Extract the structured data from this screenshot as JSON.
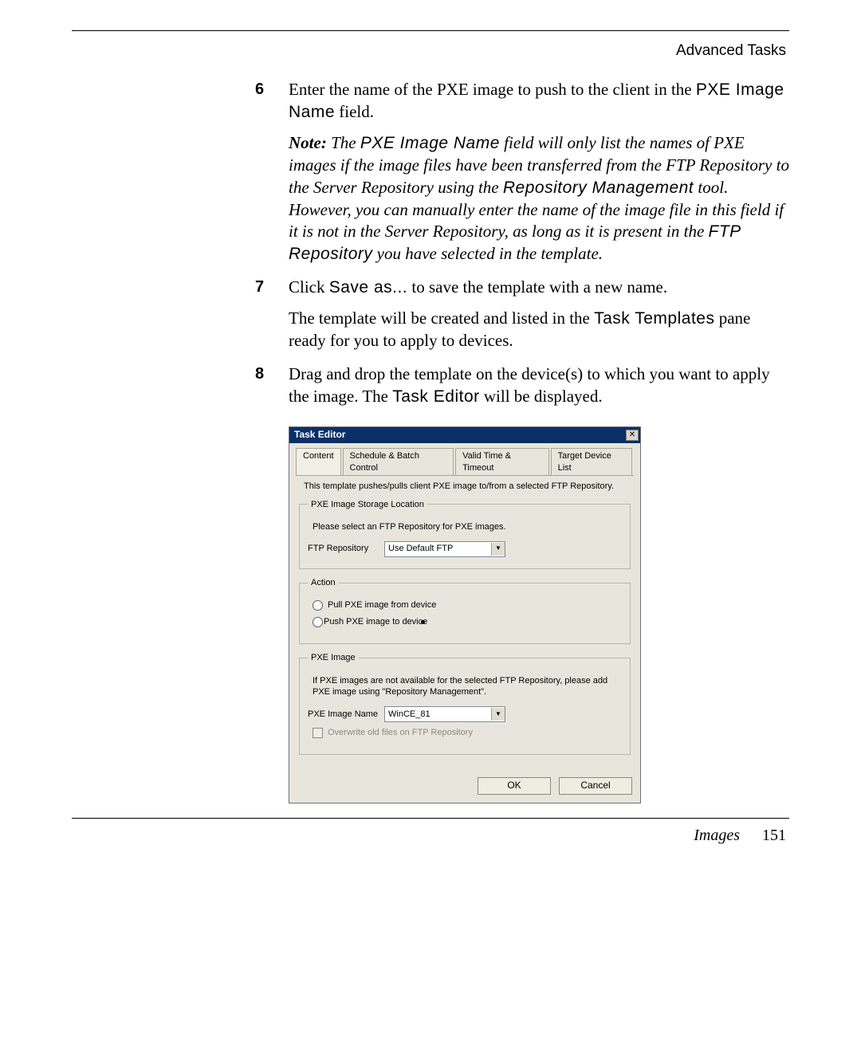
{
  "running_head": "Advanced Tasks",
  "steps": {
    "s6": {
      "num": "6",
      "pre": "Enter the name of the PXE image to push to the client in the ",
      "field1": "PXE Image Name",
      "post": " field."
    },
    "note": {
      "label": "Note:",
      "t1": " The ",
      "f1": "PXE Image Name",
      "t2": " field will only list the names of PXE images if the image files have been transferred from the FTP Repository to the Server Repository using the ",
      "f2": "Repository Management",
      "t3": " tool. However, you can manually enter the name of the image file in this field if it is not in the Server Repository, as long as it is present in the ",
      "f3": "FTP Repository",
      "t4": " you have selected in the template."
    },
    "s7": {
      "num": "7",
      "pre": "Click ",
      "btn": "Save as...",
      "post": " to save the template with a new name."
    },
    "s7b": {
      "t1": "The template will be created and listed in the ",
      "f1": "Task Templates",
      "t2": " pane ready for you to apply to devices."
    },
    "s8": {
      "num": "8",
      "t1": "Drag and drop the template on the device(s) to which you want to apply the image. The ",
      "f1": "Task Editor",
      "t2": " will be displayed."
    }
  },
  "dialog": {
    "title": "Task Editor",
    "tabs": [
      "Content",
      "Schedule & Batch Control",
      "Valid Time & Timeout",
      "Target Device List"
    ],
    "desc": "This template pushes/pulls client PXE image to/from a selected FTP Repository.",
    "group1": {
      "legend": "PXE Image Storage Location",
      "hint": "Please select an FTP Repository for PXE images.",
      "ftp_label": "FTP Repository",
      "ftp_value": "Use Default FTP"
    },
    "group2": {
      "legend": "Action",
      "opt_pull": "Pull PXE image from device",
      "opt_push": "Push PXE image to device"
    },
    "group3": {
      "legend": "PXE Image",
      "hint": "If PXE images are not available for the selected FTP Repository, please add PXE image using \"Repository Management\".",
      "name_label": "PXE Image Name",
      "name_value": "WinCE_81",
      "overwrite": "Overwrite old files on FTP Repository"
    },
    "buttons": {
      "ok": "OK",
      "cancel": "Cancel"
    }
  },
  "footer": {
    "section": "Images",
    "page": "151"
  }
}
